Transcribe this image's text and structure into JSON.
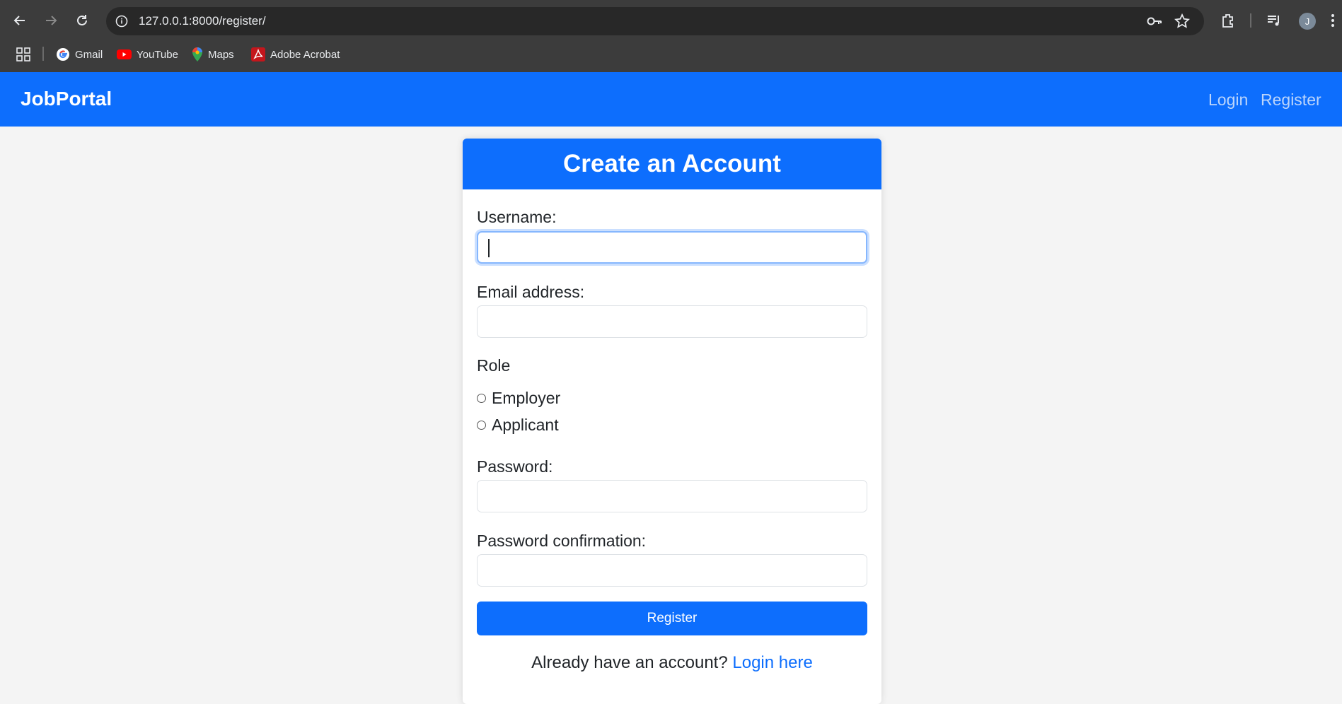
{
  "browser": {
    "url": "127.0.0.1:8000/register/",
    "avatar_initial": "J",
    "bookmarks": [
      {
        "label": "Gmail",
        "icon": "google-icon"
      },
      {
        "label": "YouTube",
        "icon": "youtube-icon"
      },
      {
        "label": "Maps",
        "icon": "maps-icon"
      },
      {
        "label": "Adobe Acrobat",
        "icon": "acrobat-icon"
      }
    ]
  },
  "navbar": {
    "brand": "JobPortal",
    "links": [
      {
        "label": "Login"
      },
      {
        "label": "Register"
      }
    ],
    "color": "#0d6efd"
  },
  "form": {
    "title": "Create an Account",
    "username_label": "Username:",
    "username_value": "",
    "email_label": "Email address:",
    "email_value": "",
    "role_label": "Role",
    "role_options": [
      {
        "label": "Employer",
        "checked": false
      },
      {
        "label": "Applicant",
        "checked": false
      }
    ],
    "password_label": "Password:",
    "password_value": "",
    "password_confirm_label": "Password confirmation:",
    "password_confirm_value": "",
    "submit_label": "Register",
    "footer_text": "Already have an account?",
    "footer_link": "Login here"
  }
}
